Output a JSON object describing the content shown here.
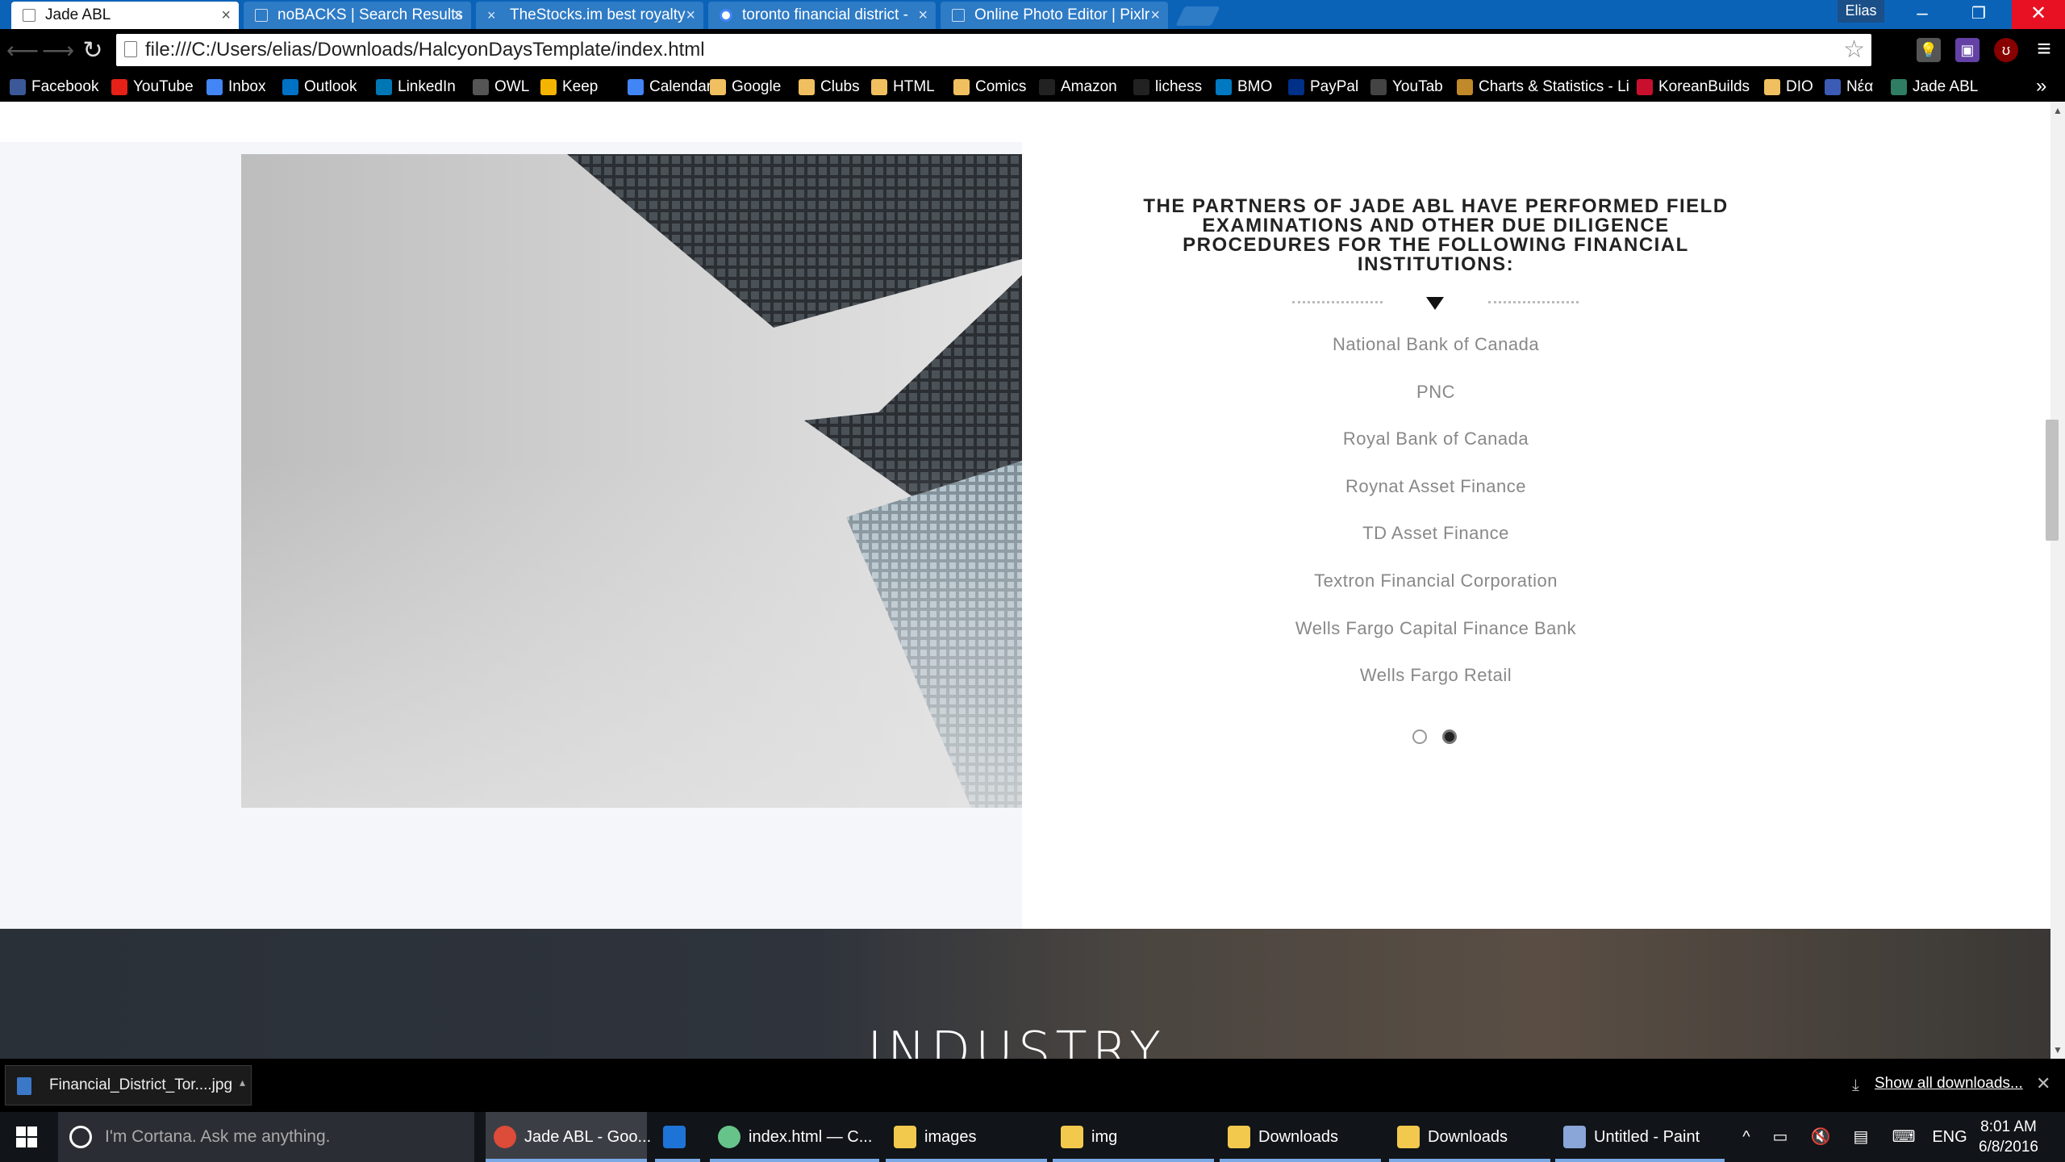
{
  "browser": {
    "tabs": [
      {
        "label": "Jade ABL",
        "active": true
      },
      {
        "label": "noBACKS | Search Results",
        "active": false
      },
      {
        "label": "TheStocks.im best royalty",
        "active": false
      },
      {
        "label": "toronto financial district -",
        "active": false
      },
      {
        "label": "Online Photo Editor | Pixlr",
        "active": false
      }
    ],
    "profile_name": "Elias",
    "url": "file:///C:/Users/elias/Downloads/HalcyonDaysTemplate/index.html",
    "bookmarks": [
      {
        "label": "Facebook",
        "icon": "facebook-icon",
        "color": "#3b5998"
      },
      {
        "label": "YouTube",
        "icon": "youtube-icon",
        "color": "#e62117"
      },
      {
        "label": "Inbox",
        "icon": "inbox-icon",
        "color": "#4285f4"
      },
      {
        "label": "Outlook",
        "icon": "outlook-icon",
        "color": "#0072c6"
      },
      {
        "label": "LinkedIn",
        "icon": "linkedin-icon",
        "color": "#0077b5"
      },
      {
        "label": "OWL",
        "icon": "owl-icon",
        "color": "#555555"
      },
      {
        "label": "Keep",
        "icon": "keep-icon",
        "color": "#f5b400"
      },
      {
        "label": "Calendar",
        "icon": "calendar-icon",
        "color": "#4285f4"
      },
      {
        "label": "Google",
        "icon": "folder-icon",
        "color": "#f0c060"
      },
      {
        "label": "Clubs",
        "icon": "folder-icon",
        "color": "#f0c060"
      },
      {
        "label": "HTML",
        "icon": "folder-icon",
        "color": "#f0c060"
      },
      {
        "label": "Comics",
        "icon": "folder-icon",
        "color": "#f0c060"
      },
      {
        "label": "Amazon",
        "icon": "amazon-icon",
        "color": "#222222"
      },
      {
        "label": "lichess",
        "icon": "lichess-icon",
        "color": "#222222"
      },
      {
        "label": "BMO",
        "icon": "bmo-icon",
        "color": "#0079c1"
      },
      {
        "label": "PayPal",
        "icon": "paypal-icon",
        "color": "#003087"
      },
      {
        "label": "YouTab",
        "icon": "youtab-icon",
        "color": "#444444"
      },
      {
        "label": "Charts & Statistics - Li",
        "icon": "charts-icon",
        "color": "#c08a2a"
      },
      {
        "label": "KoreanBuilds",
        "icon": "koreanbuilds-icon",
        "color": "#c8102e"
      },
      {
        "label": "DIO",
        "icon": "folder-icon",
        "color": "#f0c060"
      },
      {
        "label": "Νέα",
        "icon": "news-icon",
        "color": "#3b5bb5"
      },
      {
        "label": "Jade ABL",
        "icon": "jade-abl-icon",
        "color": "#2f7d62"
      }
    ]
  },
  "page": {
    "heading": "THE PARTNERS OF JADE ABL HAVE PERFORMED FIELD EXAMINATIONS AND OTHER DUE DILIGENCE PROCEDURES FOR THE FOLLOWING FINANCIAL INSTITUTIONS:",
    "institutions": [
      "National Bank of Canada",
      "PNC",
      "Royal Bank of Canada",
      "Roynat Asset Finance",
      "TD Asset Finance",
      "Textron Financial Corporation",
      "Wells Fargo Capital Finance Bank",
      "Wells Fargo Retail"
    ],
    "slider_active_index": 2,
    "slider_count": 2,
    "next_section_title": "INDUSTRY"
  },
  "downloads": {
    "file_name": "Financial_District_Tor....jpg",
    "show_all": "Show all downloads..."
  },
  "taskbar": {
    "search_placeholder": "I'm Cortana. Ask me anything.",
    "items": [
      {
        "label": "Jade ABL - Goo...",
        "icon": "chrome-icon",
        "active": true
      },
      {
        "label": "",
        "icon": "edge-icon",
        "active": false
      },
      {
        "label": "index.html — C...",
        "icon": "atom-icon",
        "active": false
      },
      {
        "label": "images",
        "icon": "folder-icon",
        "active": false
      },
      {
        "label": "img",
        "icon": "folder-icon",
        "active": false
      },
      {
        "label": "Downloads",
        "icon": "folder-icon",
        "active": false
      },
      {
        "label": "Downloads",
        "icon": "folder-icon",
        "active": false
      },
      {
        "label": "Untitled - Paint",
        "icon": "paint-icon",
        "active": false
      }
    ],
    "language": "ENG",
    "time": "8:01 AM",
    "date": "6/8/2016"
  }
}
